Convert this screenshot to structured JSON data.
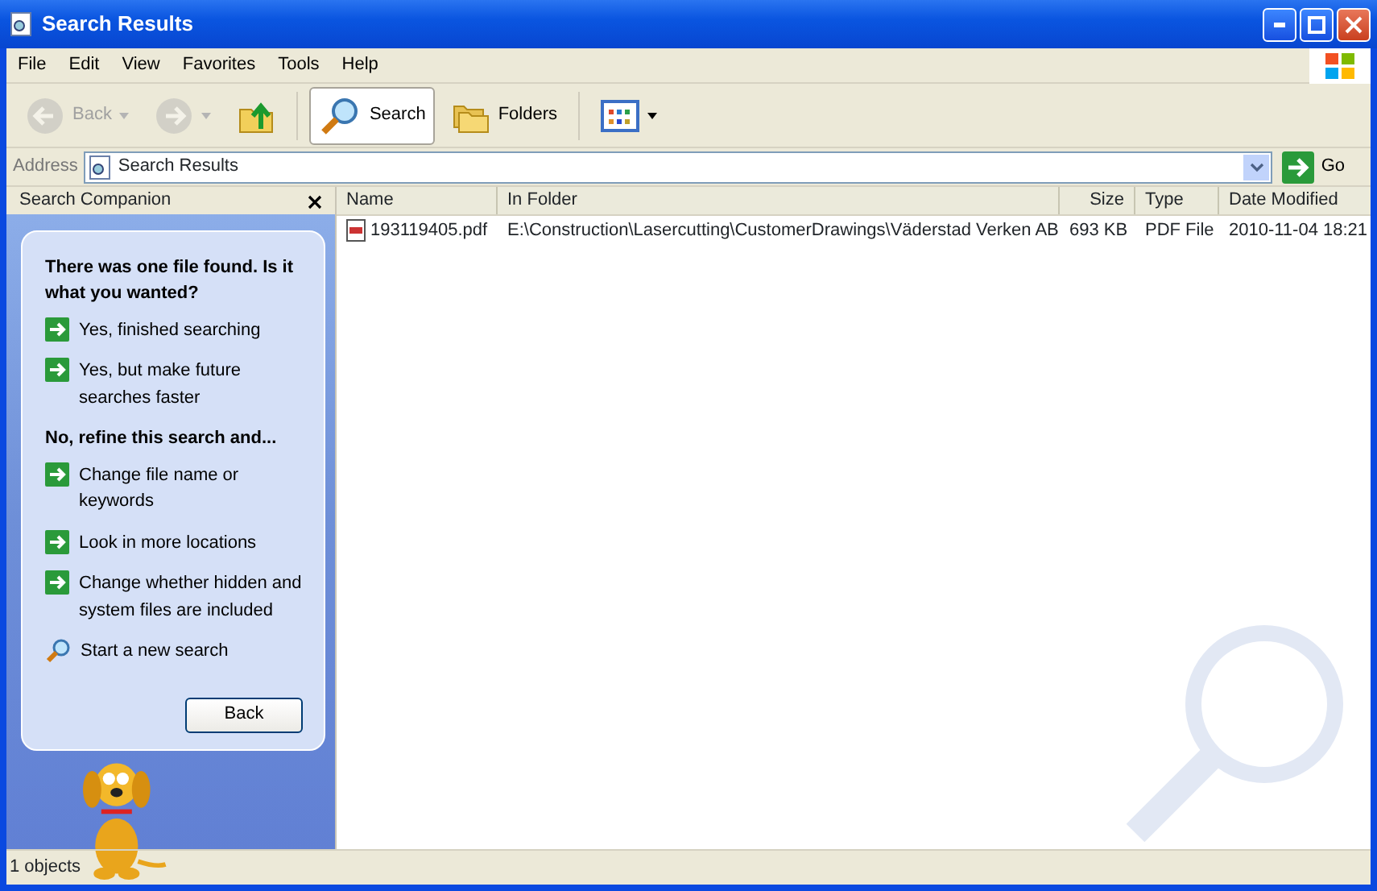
{
  "window": {
    "title": "Search Results"
  },
  "menu": [
    {
      "label": "File"
    },
    {
      "label": "Edit"
    },
    {
      "label": "View"
    },
    {
      "label": "Favorites"
    },
    {
      "label": "Tools"
    },
    {
      "label": "Help"
    }
  ],
  "toolbar": [
    {
      "kind": "back",
      "label": "Back",
      "disabled": true,
      "selected": false
    },
    {
      "kind": "forward",
      "disabled": true,
      "selected": false
    },
    {
      "kind": "up",
      "disabled": false,
      "selected": false
    },
    {
      "kind": "search",
      "label": "Search",
      "disabled": false,
      "selected": true
    },
    {
      "kind": "folders",
      "label": "Folders",
      "disabled": false,
      "selected": false
    },
    {
      "kind": "views",
      "disabled": false,
      "selected": false
    }
  ],
  "address": {
    "label": "Address",
    "value": "Search Results",
    "go_label": "Go"
  },
  "companion": {
    "title": "Search Companion",
    "items": [
      {
        "kind": "heading",
        "label": "There was one file found.  Is it what you wanted?"
      },
      {
        "kind": "arrow",
        "label": "Yes, finished searching"
      },
      {
        "kind": "arrow",
        "label": "Yes, but make future searches faster"
      },
      {
        "kind": "heading",
        "label": "No, refine this search and..."
      },
      {
        "kind": "arrow",
        "label": "Change file name or keywords"
      },
      {
        "kind": "arrow",
        "label": "Look in more locations"
      },
      {
        "kind": "arrow",
        "label": "Change whether hidden and system files are included"
      },
      {
        "kind": "search",
        "label": "Start a new search"
      }
    ],
    "back_button": "Back"
  },
  "table": {
    "columns": [
      "Name",
      "In Folder",
      "Size",
      "Type",
      "Date Modified"
    ],
    "rows": [
      [
        "193119405.pdf",
        "E:\\Construction\\Lasercutting\\CustomerDrawings\\Väderstad Verken AB",
        "693 KB",
        "PDF File",
        "2010-11-04 18:21"
      ]
    ]
  },
  "status_bar": "1 objects"
}
